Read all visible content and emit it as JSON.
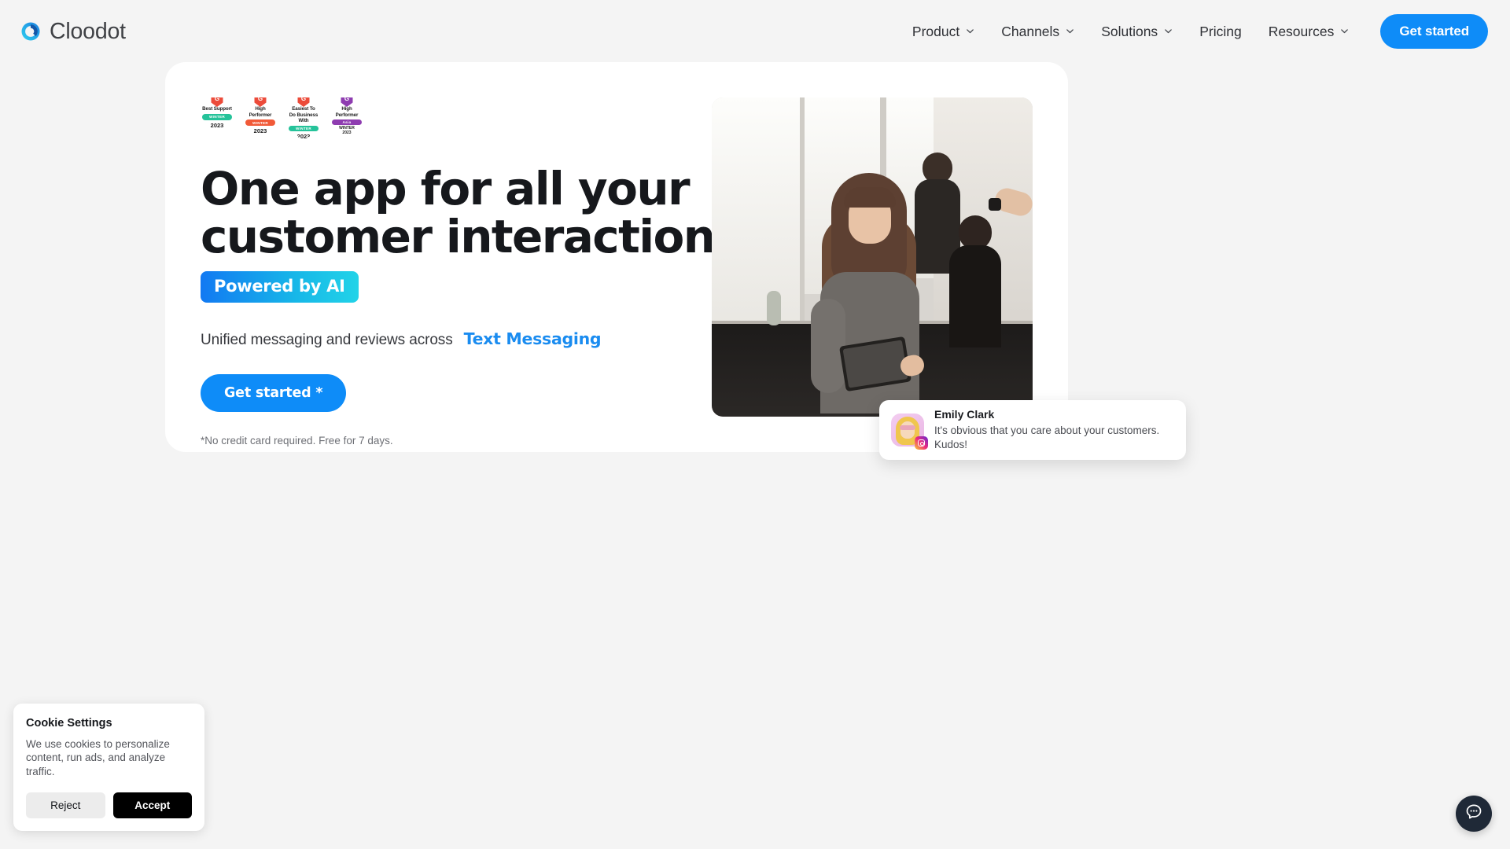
{
  "header": {
    "brand": "Cloodot",
    "nav": [
      {
        "label": "Product",
        "has_dropdown": true
      },
      {
        "label": "Channels",
        "has_dropdown": true
      },
      {
        "label": "Solutions",
        "has_dropdown": true
      },
      {
        "label": "Pricing",
        "has_dropdown": false
      },
      {
        "label": "Resources",
        "has_dropdown": true
      }
    ],
    "cta_label": "Get started"
  },
  "hero": {
    "badges": [
      {
        "title": "Best Support",
        "season": "WINTER",
        "year": "2023",
        "color": "#25c39a",
        "region": ""
      },
      {
        "title": "High Performer",
        "season": "WINTER",
        "year": "2023",
        "color": "#f15a38",
        "region": ""
      },
      {
        "title": "Easiest To Do Business With",
        "season": "WINTER",
        "year": "2023",
        "color": "#25c39a",
        "region": ""
      },
      {
        "title": "High Performer",
        "season": "WINTER",
        "year": "2023",
        "color": "#8e3cb0",
        "region": "Asia"
      }
    ],
    "headline_line1": "One app for all your",
    "headline_line2": "customer interactions",
    "ai_pill": "Powered by AI",
    "subline_prefix": "Unified messaging and reviews across",
    "subline_highlight": "Text Messaging",
    "cta_label": "Get started *",
    "disclaimer": "*No credit card required. Free for 7 days."
  },
  "testimonial": {
    "name": "Emily Clark",
    "message": "It's obvious that you care about your customers. Kudos!",
    "channel": "instagram"
  },
  "cookie": {
    "title": "Cookie Settings",
    "text": "We use cookies to personalize content, run ads, and analyze traffic.",
    "reject_label": "Reject",
    "accept_label": "Accept"
  },
  "colors": {
    "accent_blue": "#0e8cf8",
    "page_bg": "#f4f4f4",
    "card_bg": "#ffffff",
    "text_dark": "#16181c"
  }
}
